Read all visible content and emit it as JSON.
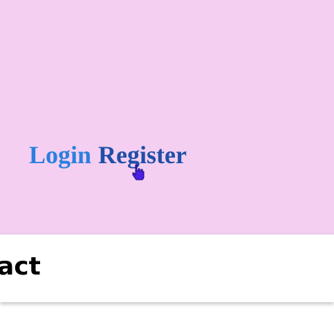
{
  "auth": {
    "login_label": "Login",
    "register_label": "Register"
  },
  "card": {
    "title": "act"
  },
  "colors": {
    "panel_background": "#f4cff1",
    "login": "#2a7fe0",
    "register": "#1f4fa8",
    "cursor": "#4b1fe0"
  },
  "icons": {
    "cursor": "pointer-hand-icon"
  }
}
